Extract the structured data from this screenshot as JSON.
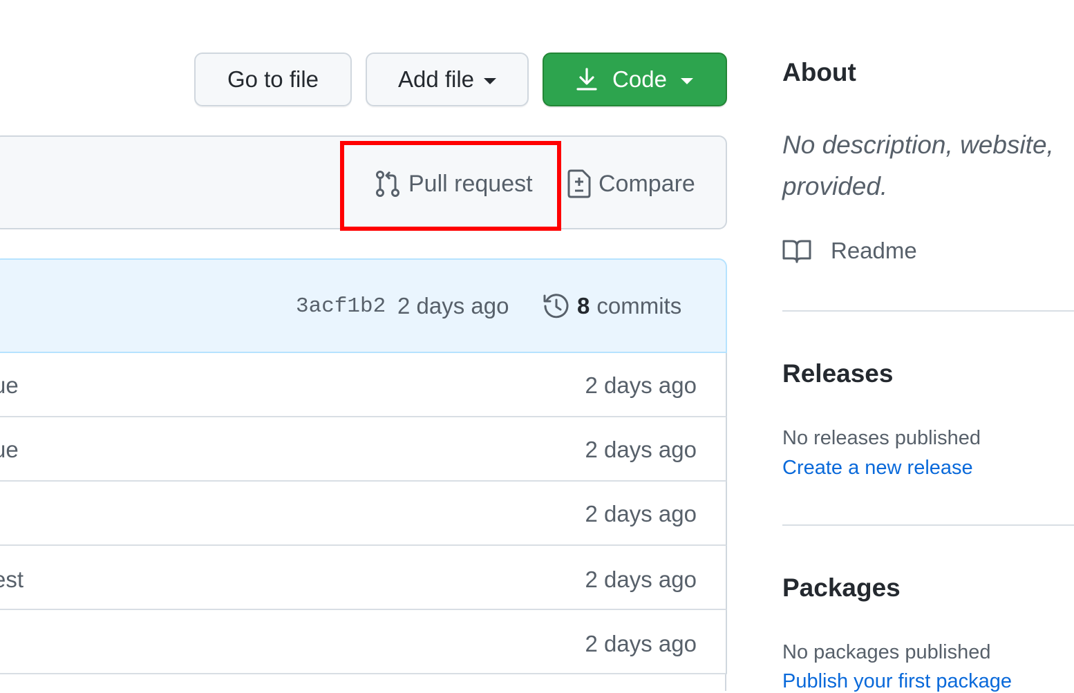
{
  "toolbar": {
    "go_to_file_label": "Go to file",
    "add_file_label": "Add file",
    "code_label": "Code"
  },
  "branch_bar": {
    "pull_request_label": "Pull request",
    "compare_label": "Compare"
  },
  "latest_commit": {
    "sha": "3acf1b2",
    "age": "2 days ago",
    "commit_count": "8",
    "commits_label": "commits"
  },
  "files": [
    {
      "name": "ue",
      "age": "2 days ago"
    },
    {
      "name": "ue",
      "age": "2 days ago"
    },
    {
      "name": "",
      "age": "2 days ago"
    },
    {
      "name": "est",
      "age": "2 days ago"
    },
    {
      "name": "",
      "age": "2 days ago"
    }
  ],
  "sidebar": {
    "about_heading": "About",
    "about_description_line1": "No description, website,",
    "about_description_line2": "provided.",
    "readme_label": "Readme",
    "releases_heading": "Releases",
    "releases_empty": "No releases published",
    "releases_link": "Create a new release",
    "packages_heading": "Packages",
    "packages_empty": "No packages published",
    "packages_link": "Publish your first package"
  },
  "colors": {
    "primary_green": "#2da44e",
    "link_blue": "#0969da",
    "highlight_red": "#ff0000",
    "commit_bar_bg": "#eaf5fe"
  }
}
